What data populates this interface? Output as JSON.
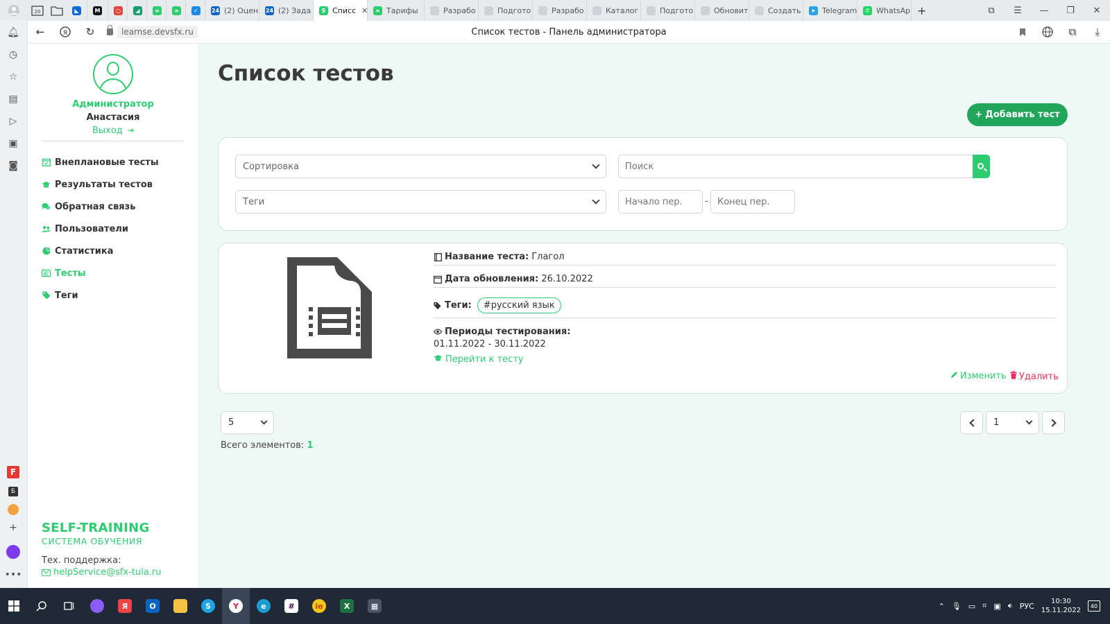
{
  "browser": {
    "tabs": [
      {
        "label": "",
        "color": "#0b6ad8",
        "glyph": "◣"
      },
      {
        "label": "",
        "color": "#111111",
        "glyph": "M"
      },
      {
        "label": "",
        "color": "#e0463b",
        "glyph": "○"
      },
      {
        "label": "",
        "color": "#1a9b6b",
        "glyph": "◢"
      },
      {
        "label": "",
        "color": "#2ecc71",
        "glyph": "∞"
      },
      {
        "label": "",
        "color": "#2ecc71",
        "glyph": "∞"
      },
      {
        "label": "",
        "color": "#1e88e5",
        "glyph": "✓"
      },
      {
        "label": "(2) Оцен",
        "color": "#1565c0",
        "glyph": "24"
      },
      {
        "label": "(2) Зада",
        "color": "#1565c0",
        "glyph": "24"
      },
      {
        "label": "Списс",
        "color": "#2ecc71",
        "glyph": "S",
        "active": true
      },
      {
        "label": "Тарифы",
        "color": "#2ecc71",
        "glyph": "∞"
      },
      {
        "label": "Разрабо",
        "color": "#cfd3d7",
        "glyph": ""
      },
      {
        "label": "Подгото",
        "color": "#cfd3d7",
        "glyph": ""
      },
      {
        "label": "Разрабо",
        "color": "#cfd3d7",
        "glyph": ""
      },
      {
        "label": "Каталог",
        "color": "#cfd3d7",
        "glyph": ""
      },
      {
        "label": "Подгото",
        "color": "#cfd3d7",
        "glyph": ""
      },
      {
        "label": "Обновит",
        "color": "#cfd3d7",
        "glyph": ""
      },
      {
        "label": "Создать",
        "color": "#cfd3d7",
        "glyph": ""
      },
      {
        "label": "Telegram",
        "color": "#2aa3e0",
        "glyph": "➤"
      },
      {
        "label": "WhatsAp",
        "color": "#25d366",
        "glyph": "✆"
      }
    ],
    "url": "learnse.devsfx.ru",
    "page_title": "Список тестов - Панель администратора"
  },
  "user": {
    "role": "Администратор",
    "name": "Анастасия",
    "logout_label": "Выход"
  },
  "nav": {
    "items": [
      {
        "label": "Внеплановые тесты",
        "icon": "calendar-icon"
      },
      {
        "label": "Результаты тестов",
        "icon": "graduation-cap-icon"
      },
      {
        "label": "Обратная связь",
        "icon": "comments-icon"
      },
      {
        "label": "Пользователи",
        "icon": "users-icon"
      },
      {
        "label": "Статистика",
        "icon": "pie-chart-icon"
      },
      {
        "label": "Тесты",
        "icon": "tests-icon",
        "active": true
      },
      {
        "label": "Теги",
        "icon": "tag-icon"
      }
    ]
  },
  "brand": {
    "title": "SELF-TRAINING",
    "subtitle": "СИСТЕМА ОБУЧЕНИЯ",
    "support_label": "Тех. поддержка:",
    "support_email": "helpService@sfx-tula.ru"
  },
  "page": {
    "title": "Список тестов",
    "add_button": "Добавить тест"
  },
  "filters": {
    "sort_placeholder": "Сортировка",
    "search_placeholder": "Поиск",
    "tags_placeholder": "Теги",
    "start_placeholder": "Начало пер.",
    "end_placeholder": "Конец пер.",
    "range_separator": "-"
  },
  "test_card": {
    "name_label": "Название теста:",
    "name_value": "Глагол",
    "updated_label": "Дата обновления:",
    "updated_value": "26.10.2022",
    "tags_label": "Теги:",
    "tag": "#русский язык",
    "periods_label": "Периоды тестирования:",
    "period": "01.11.2022 - 30.11.2022",
    "goto_label": "Перейти к тесту",
    "edit_label": "Изменить",
    "delete_label": "Удалить"
  },
  "pagination": {
    "page_size": "5",
    "current_page": "1",
    "total_label": "Всего элементов:",
    "total_value": "1"
  },
  "taskbar": {
    "language": "РУС",
    "time": "10:30",
    "date": "15.11.2022",
    "notifications": "40"
  },
  "colors": {
    "accent": "#2ecc71",
    "add_button": "#21a55b",
    "delete": "#e8315a",
    "content_bg": "#eef8f5"
  }
}
